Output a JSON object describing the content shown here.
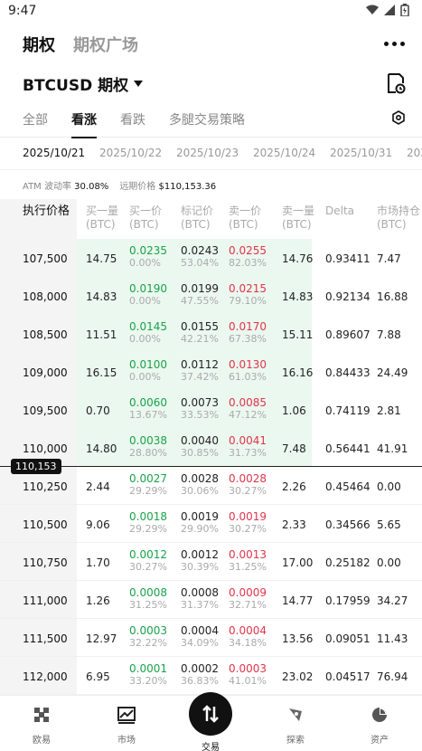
{
  "status_bar": {
    "time": "9:47"
  },
  "top_tabs": [
    {
      "label": "期权",
      "active": true
    },
    {
      "label": "期权广场",
      "active": false
    }
  ],
  "instrument": {
    "label": "BTCUSD 期权"
  },
  "filter_tabs": [
    {
      "label": "全部",
      "active": false
    },
    {
      "label": "看涨",
      "active": true
    },
    {
      "label": "看跌",
      "active": false
    },
    {
      "label": "多腿交易策略",
      "active": false
    }
  ],
  "dates": [
    {
      "label": "2025/10/21",
      "active": true
    },
    {
      "label": "2025/10/22",
      "active": false
    },
    {
      "label": "2025/10/23",
      "active": false
    },
    {
      "label": "2025/10/24",
      "active": false
    },
    {
      "label": "2025/10/31",
      "active": false
    },
    {
      "label": "202",
      "active": false
    }
  ],
  "meta": {
    "atm_iv_label": "ATM 波动率",
    "atm_iv_value": "30.08%",
    "forward_label": "远期价格",
    "forward_value": "$110,153.36"
  },
  "table": {
    "headers": {
      "strike": "执行价格",
      "bid_size": [
        "买一量",
        "(BTC)"
      ],
      "bid": [
        "买一价",
        "(BTC)"
      ],
      "mark": [
        "标记价",
        "(BTC)"
      ],
      "ask": [
        "卖一价",
        "(BTC)"
      ],
      "ask_size": [
        "卖一量",
        "(BTC)"
      ],
      "delta": [
        "Delta",
        ""
      ],
      "open_interest": [
        "市场持仓",
        "(BTC)"
      ]
    },
    "atm_price": "110,153",
    "rows": [
      {
        "strike": "107,500",
        "bid_size": "14.75",
        "bid": "0.0235",
        "bid_iv": "0.00%",
        "mark": "0.0243",
        "mark_iv": "53.04%",
        "ask": "0.0255",
        "ask_iv": "82.03%",
        "ask_size": "14.76",
        "delta": "0.93411",
        "oi": "7.47"
      },
      {
        "strike": "108,000",
        "bid_size": "14.83",
        "bid": "0.0190",
        "bid_iv": "0.00%",
        "mark": "0.0199",
        "mark_iv": "47.55%",
        "ask": "0.0215",
        "ask_iv": "79.10%",
        "ask_size": "14.83",
        "delta": "0.92134",
        "oi": "16.88"
      },
      {
        "strike": "108,500",
        "bid_size": "11.51",
        "bid": "0.0145",
        "bid_iv": "0.00%",
        "mark": "0.0155",
        "mark_iv": "42.21%",
        "ask": "0.0170",
        "ask_iv": "67.38%",
        "ask_size": "15.11",
        "delta": "0.89607",
        "oi": "7.88"
      },
      {
        "strike": "109,000",
        "bid_size": "16.15",
        "bid": "0.0100",
        "bid_iv": "0.00%",
        "mark": "0.0112",
        "mark_iv": "37.42%",
        "ask": "0.0130",
        "ask_iv": "61.03%",
        "ask_size": "16.16",
        "delta": "0.84433",
        "oi": "24.49"
      },
      {
        "strike": "109,500",
        "bid_size": "0.70",
        "bid": "0.0060",
        "bid_iv": "13.67%",
        "mark": "0.0073",
        "mark_iv": "33.53%",
        "ask": "0.0085",
        "ask_iv": "47.12%",
        "ask_size": "1.06",
        "delta": "0.74119",
        "oi": "2.81"
      },
      {
        "strike": "110,000",
        "bid_size": "14.80",
        "bid": "0.0038",
        "bid_iv": "28.80%",
        "mark": "0.0040",
        "mark_iv": "30.85%",
        "ask": "0.0041",
        "ask_iv": "31.73%",
        "ask_size": "7.48",
        "delta": "0.56441",
        "oi": "41.91"
      },
      {
        "strike": "110,250",
        "bid_size": "2.44",
        "bid": "0.0027",
        "bid_iv": "29.29%",
        "mark": "0.0028",
        "mark_iv": "30.06%",
        "ask": "0.0028",
        "ask_iv": "30.27%",
        "ask_size": "2.26",
        "delta": "0.45464",
        "oi": "0.00"
      },
      {
        "strike": "110,500",
        "bid_size": "9.06",
        "bid": "0.0018",
        "bid_iv": "29.29%",
        "mark": "0.0019",
        "mark_iv": "29.90%",
        "ask": "0.0019",
        "ask_iv": "30.27%",
        "ask_size": "2.33",
        "delta": "0.34566",
        "oi": "5.65"
      },
      {
        "strike": "110,750",
        "bid_size": "1.70",
        "bid": "0.0012",
        "bid_iv": "30.27%",
        "mark": "0.0012",
        "mark_iv": "30.39%",
        "ask": "0.0013",
        "ask_iv": "31.25%",
        "ask_size": "17.00",
        "delta": "0.25182",
        "oi": "0.00"
      },
      {
        "strike": "111,000",
        "bid_size": "1.26",
        "bid": "0.0008",
        "bid_iv": "31.25%",
        "mark": "0.0008",
        "mark_iv": "31.37%",
        "ask": "0.0009",
        "ask_iv": "32.71%",
        "ask_size": "14.77",
        "delta": "0.17959",
        "oi": "34.27"
      },
      {
        "strike": "111,500",
        "bid_size": "12.97",
        "bid": "0.0003",
        "bid_iv": "32.22%",
        "mark": "0.0004",
        "mark_iv": "34.09%",
        "ask": "0.0004",
        "ask_iv": "34.18%",
        "ask_size": "13.56",
        "delta": "0.09051",
        "oi": "11.43"
      },
      {
        "strike": "112,000",
        "bid_size": "6.95",
        "bid": "0.0001",
        "bid_iv": "33.20%",
        "mark": "0.0002",
        "mark_iv": "36.83%",
        "ask": "0.0003",
        "ask_iv": "41.01%",
        "ask_size": "23.02",
        "delta": "0.04517",
        "oi": "76.94"
      }
    ]
  },
  "bottom_nav": [
    {
      "label": "欧易",
      "icon": "okx-logo-icon"
    },
    {
      "label": "市场",
      "icon": "market-chart-icon"
    },
    {
      "label": "交易",
      "icon": "trade-swap-icon"
    },
    {
      "label": "探索",
      "icon": "explore-compass-icon"
    },
    {
      "label": "资产",
      "icon": "assets-pie-icon"
    }
  ],
  "colors": {
    "bid": "#19a34a",
    "ask": "#e0344b",
    "itm_band": "#ebf8ef"
  }
}
